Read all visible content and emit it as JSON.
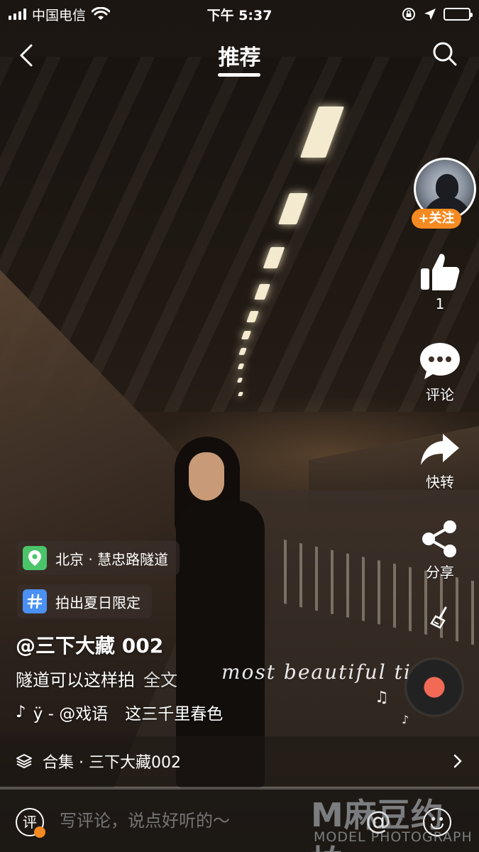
{
  "status_bar": {
    "carrier": "中国电信",
    "time": "下午 5:37",
    "icons": [
      "signal-icon",
      "wifi-icon",
      "rotation-lock-icon",
      "location-icon",
      "battery-charging-icon"
    ]
  },
  "header": {
    "title": "推荐",
    "back_icon": "chevron-left-icon",
    "search_icon": "search-icon"
  },
  "rail": {
    "follow_label": "+关注",
    "like_count": "1",
    "comment_label": "评论",
    "repost_label": "快转",
    "share_label": "分享",
    "clean_icon": "broom-icon"
  },
  "tags": {
    "location": "北京 · 慧忠路隧道",
    "topic": "拍出夏日限定"
  },
  "post": {
    "author": "@三下大藏 002",
    "caption": "隧道可以这样拍",
    "more_label": "全文",
    "music_prefix": "♪",
    "music_fragment": "ÿ - @戏语",
    "song": "这三千里春色"
  },
  "overlay": {
    "cursive_text": "most beautiful ti"
  },
  "collection": {
    "label": "合集 · 三下大藏002"
  },
  "comment_bar": {
    "ping_label": "评",
    "placeholder": "写评论，说点好听的～",
    "at_label": "@"
  },
  "watermark": {
    "brand": "M麻豆约拍",
    "sub": "MODEL PHOTOGRAPH"
  },
  "colors": {
    "accent_orange": "#f48a21",
    "location_green": "#4cc46a",
    "topic_blue": "#4a90f5",
    "disc_center": "#f26a56"
  }
}
